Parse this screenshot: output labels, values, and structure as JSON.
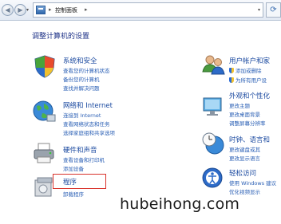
{
  "window": {
    "address_crumb": "控制面板",
    "separator": "▸"
  },
  "heading": "调整计算机的设置",
  "left_categories": [
    {
      "name": "system-security",
      "title": "系统和安全",
      "links": [
        "查看您的计算机状态",
        "备份您的计算机",
        "查找并解决问题"
      ],
      "icon": "shield-flag-icon"
    },
    {
      "name": "network-internet",
      "title": "网络和 Internet",
      "links": [
        "连接到 Internet",
        "查看网络状态和任务",
        "选择家庭组和共享选项"
      ],
      "icon": "globe-network-icon"
    },
    {
      "name": "hardware-sound",
      "title": "硬件和声音",
      "links": [
        "查看设备和打印机",
        "添加设备"
      ],
      "icon": "printer-icon"
    },
    {
      "name": "programs",
      "title": "程序",
      "links": [
        "卸载程序"
      ],
      "icon": "programs-icon"
    }
  ],
  "right_categories": [
    {
      "name": "user-accounts",
      "title": "用户帐户和家",
      "links": [
        "添加或删除",
        "为所有用户设"
      ],
      "shield_links": [
        true,
        true
      ],
      "icon": "users-icon"
    },
    {
      "name": "appearance",
      "title": "外观和个性化",
      "links": [
        "更改主题",
        "更改桌面背景",
        "调整屏幕分辨率"
      ],
      "icon": "appearance-icon"
    },
    {
      "name": "clock-region",
      "title": "时钟、语言和",
      "links": [
        "更改键盘或其",
        "更改显示语言"
      ],
      "icon": "clock-globe-icon"
    },
    {
      "name": "ease-of-access",
      "title": "轻松访问",
      "links": [
        "使用 Windows 建议",
        "优化视频显示"
      ],
      "icon": "ease-of-access-icon"
    }
  ],
  "watermark": "hubeihong.com",
  "colors": {
    "link": "#2a5fb5",
    "title": "#1b4aa0",
    "highlight": "#d9322b"
  }
}
